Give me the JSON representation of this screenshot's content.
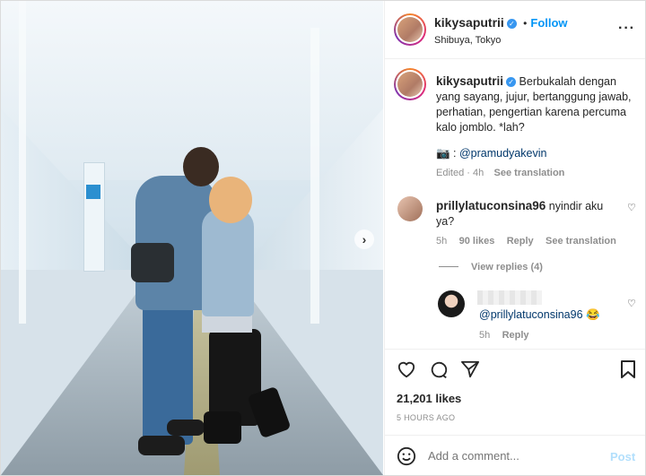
{
  "post": {
    "username": "kikysaputrii",
    "follow_label": "Follow",
    "location": "Shibuya, Tokyo",
    "more_icon": "more-dots-icon"
  },
  "caption": {
    "username": "kikysaputrii",
    "text": "Berbukalah dengan yang sayang, jujur, bertanggung jawab, perhatian, pengertian karena percuma kalo jomblo. *lah?",
    "credit_prefix": "📷 : ",
    "credit_mention": "@pramudyakevin",
    "edited": "Edited · 4h",
    "see_translation": "See translation"
  },
  "comments": [
    {
      "username": "prillylatuconsina96",
      "text": "nyindir aku ya?",
      "age": "5h",
      "likes": "90 likes",
      "reply": "Reply",
      "see_translation": "See translation",
      "view_replies": "View replies (4)"
    }
  ],
  "reply": {
    "mention": "@prillylatuconsina96",
    "emoji": "😂",
    "age": "5h",
    "reply": "Reply"
  },
  "stats": {
    "likes": "21,201 likes",
    "time": "5 HOURS AGO"
  },
  "add_comment": {
    "placeholder": "Add a comment...",
    "post_label": "Post"
  }
}
